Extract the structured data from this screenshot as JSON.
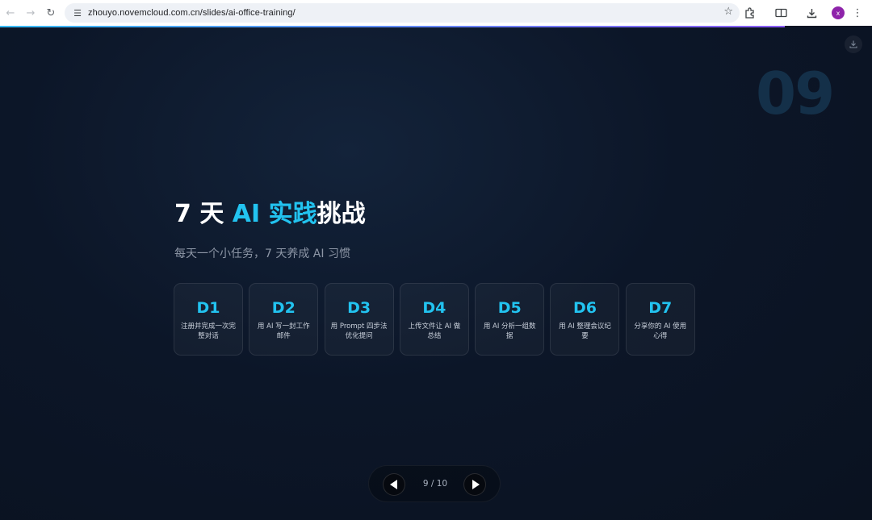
{
  "browser": {
    "url": "zhouyo.novemcloud.com.cn/slides/ai-office-training/",
    "avatar_initial": "x",
    "icons": {
      "back": "arrow-left-icon",
      "forward": "arrow-right-icon",
      "reload": "reload-icon",
      "site_info": "tune-icon",
      "bookmark": "star-icon",
      "extensions": "puzzle-icon",
      "reading_mode": "book-icon",
      "downloads": "download-icon",
      "menu": "kebab-icon"
    }
  },
  "progress": {
    "fraction": 0.9
  },
  "slide": {
    "number": "09",
    "title_prefix": "7 天 ",
    "title_accent": "AI 实践",
    "title_suffix": "挑战",
    "subtitle": "每天一个小任务，7 天养成 AI 习惯",
    "accent_color": "#22c3f0",
    "days": [
      {
        "day": "D1",
        "task": "注册并完成一次完整对话"
      },
      {
        "day": "D2",
        "task": "用 AI 写一封工作邮件"
      },
      {
        "day": "D3",
        "task": "用 Prompt 四步法优化提问"
      },
      {
        "day": "D4",
        "task": "上传文件让 AI 做总结"
      },
      {
        "day": "D5",
        "task": "用 AI 分析一组数据"
      },
      {
        "day": "D6",
        "task": "用 AI 整理会议纪要"
      },
      {
        "day": "D7",
        "task": "分享你的 AI 使用心得"
      }
    ]
  },
  "pager": {
    "counter": "9 / 10"
  }
}
